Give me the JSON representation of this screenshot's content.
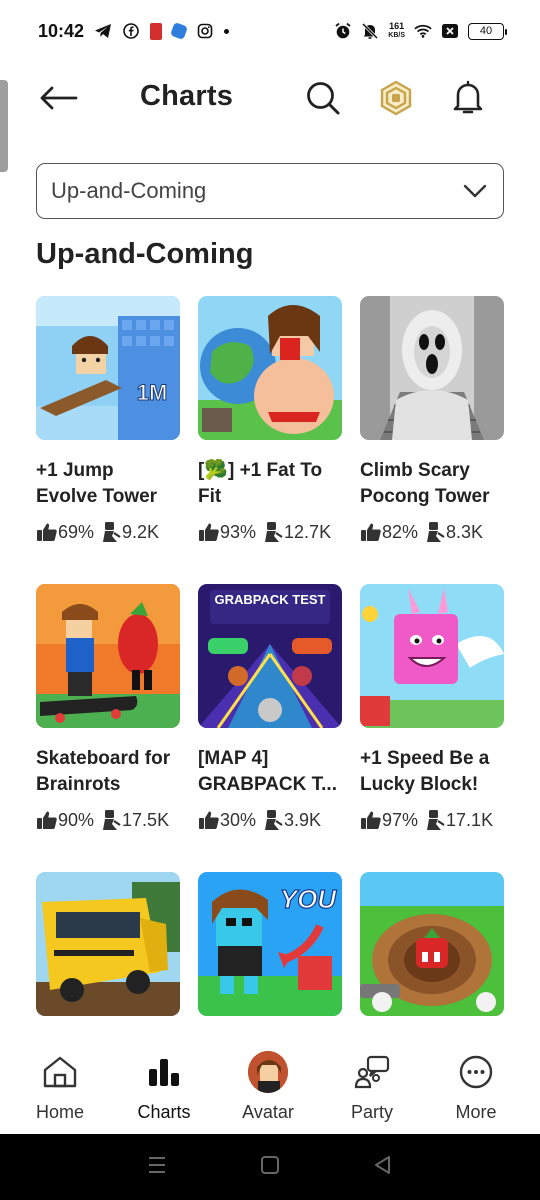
{
  "status_bar": {
    "time": "10:42",
    "net_speed_top": "161",
    "net_speed_bottom": "KB/S",
    "battery": "40"
  },
  "header": {
    "title": "Charts",
    "back_icon": "arrow-left-icon",
    "search_icon": "search-icon",
    "robux_icon": "robux-icon",
    "notifications_icon": "bell-icon"
  },
  "filter": {
    "selected": "Up-and-Coming"
  },
  "section": {
    "title": "Up-and-Coming"
  },
  "games": [
    {
      "title": "+1 Jump Evolve Tower",
      "rating": "69%",
      "players": "9.2K"
    },
    {
      "title": "[🥦] +1 Fat To Fit",
      "rating": "93%",
      "players": "12.7K"
    },
    {
      "title": "Climb Scary Pocong Tower",
      "rating": "82%",
      "players": "8.3K"
    },
    {
      "title": "Skateboard for Brainrots",
      "rating": "90%",
      "players": "17.5K"
    },
    {
      "title": "[MAP 4] GRABPACK T...",
      "rating": "30%",
      "players": "3.9K"
    },
    {
      "title": "+1 Speed Be a Lucky Block!",
      "rating": "97%",
      "players": "17.1K"
    },
    {
      "title": "",
      "rating": "",
      "players": ""
    },
    {
      "title": "",
      "rating": "",
      "players": ""
    },
    {
      "title": "",
      "rating": "",
      "players": ""
    }
  ],
  "thumb_text": {
    "jump": "1M",
    "grabpack": "GRABPACK TEST",
    "you": "YOU"
  },
  "bottom_nav": {
    "home": "Home",
    "charts": "Charts",
    "avatar": "Avatar",
    "party": "Party",
    "more": "More"
  }
}
